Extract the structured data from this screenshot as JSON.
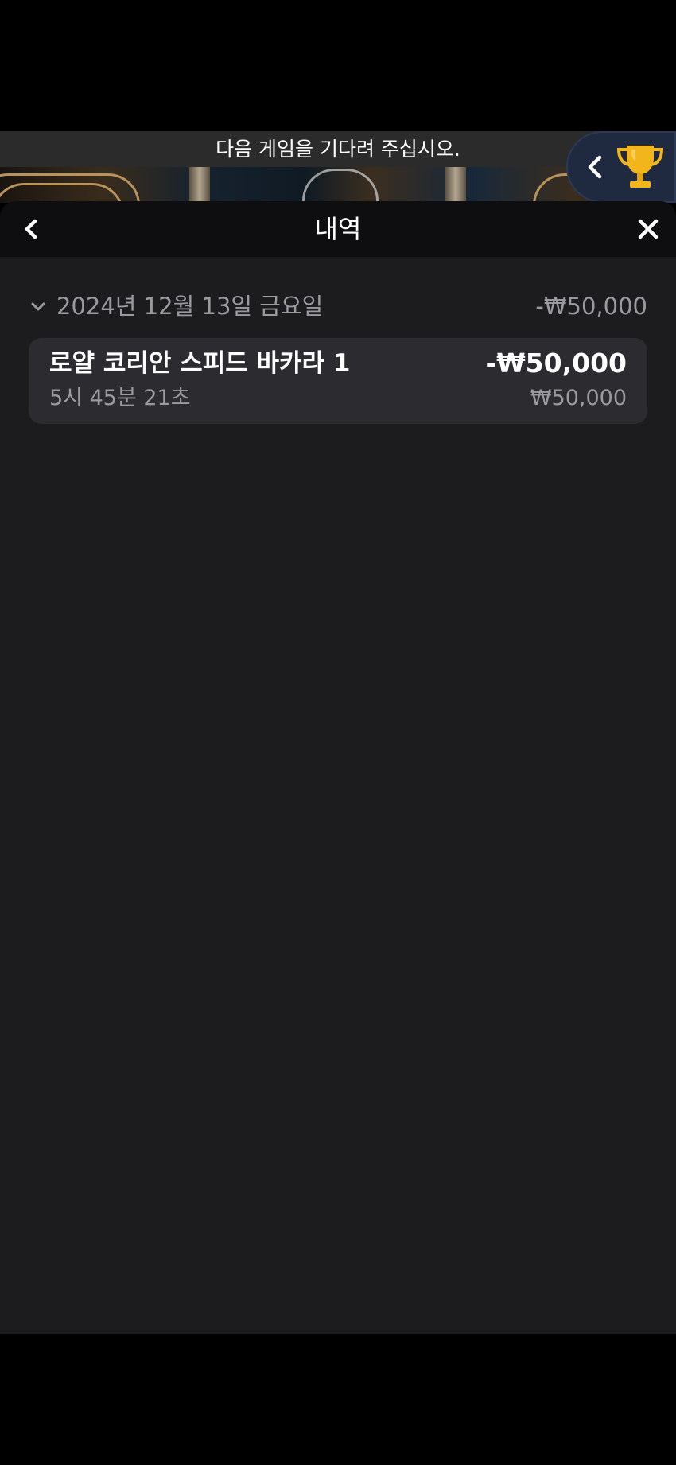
{
  "game": {
    "status_message": "다음 게임을 기다려 주십시오.",
    "trophy_icon": "trophy-icon",
    "collapse_icon": "chevron-left-icon"
  },
  "history_panel": {
    "title": "내역",
    "back_icon": "chevron-left-icon",
    "close_icon": "close-icon",
    "days": [
      {
        "date": "2024년 12월 13일 금요일",
        "total": "-₩50,000",
        "expand_icon": "chevron-down-icon",
        "bets": [
          {
            "game_name": "로얄 코리안 스피드 바카라 1",
            "result": "-₩50,000",
            "time": "5시 45분 21초",
            "stake": "₩50,000"
          }
        ]
      }
    ]
  },
  "colors": {
    "panel_background": "#1c1b1e",
    "header_background": "#0e0d10",
    "card_background": "#2c2b30",
    "muted_text": "#9b9a9f",
    "trophy_gold": "#f2b51c"
  }
}
